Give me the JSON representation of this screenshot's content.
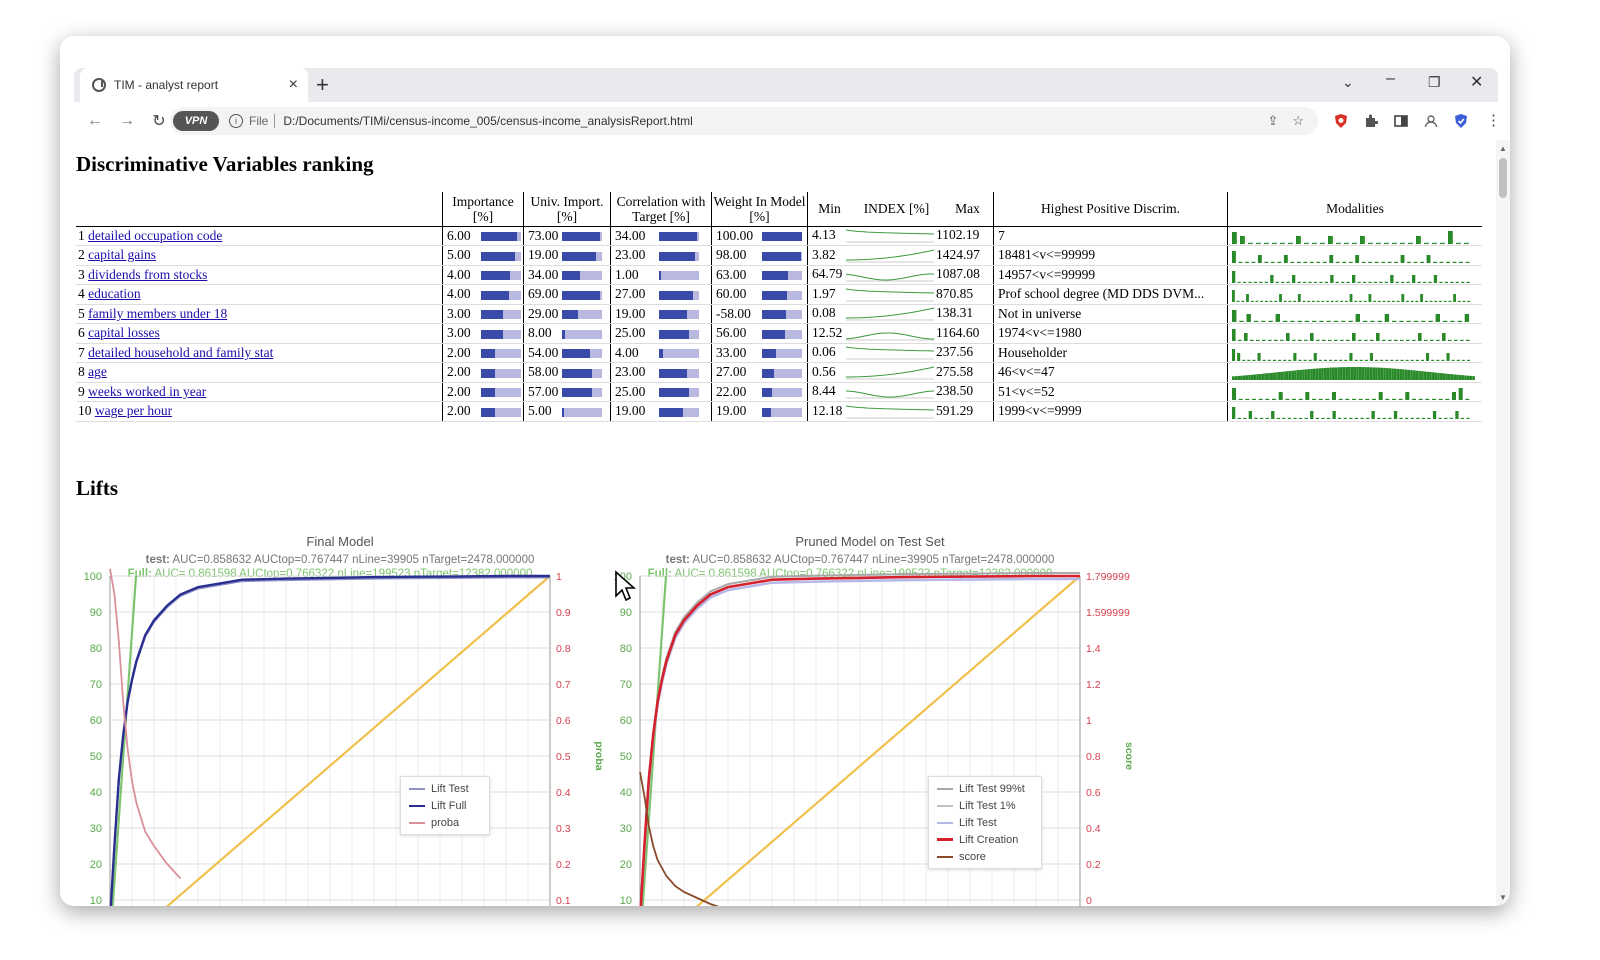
{
  "browser": {
    "tab_title": "TIM - analyst report",
    "new_tab": "+",
    "vpn_label": "VPN",
    "file_label": "File",
    "url": "D:/Documents/TIMi/census-income_005/census-income_analysisReport.html"
  },
  "ranking": {
    "heading": "Discriminative Variables ranking",
    "headers": {
      "importance": "Importance [%]",
      "univ_import": "Univ. Import. [%]",
      "correlation": "Correlation with Target [%]",
      "weight": "Weight In Model [%]",
      "min": "Min",
      "index": "INDEX [%]",
      "max": "Max",
      "highest": "Highest Positive Discrim.",
      "modalities": "Modalities"
    },
    "rows": [
      {
        "rank": "1",
        "name": "detailed occupation code",
        "importance": "6.00",
        "imp_frac": 0.9,
        "univ": "73.00",
        "univ_frac": 0.95,
        "corr": "34.00",
        "corr_frac": 0.95,
        "weight": "100.00",
        "weight_frac": 1.0,
        "min": "4.13",
        "max": "1102.19",
        "highest": "7"
      },
      {
        "rank": "2",
        "name": "capital gains",
        "importance": "5.00",
        "imp_frac": 0.85,
        "univ": "19.00",
        "univ_frac": 0.85,
        "corr": "23.00",
        "corr_frac": 0.9,
        "weight": "98.00",
        "weight_frac": 0.98,
        "min": "3.82",
        "max": "1424.97",
        "highest": "18481<v<=99999"
      },
      {
        "rank": "3",
        "name": "dividends from stocks",
        "importance": "4.00",
        "imp_frac": 0.72,
        "univ": "34.00",
        "univ_frac": 0.45,
        "corr": "1.00",
        "corr_frac": 0.05,
        "weight": "63.00",
        "weight_frac": 0.65,
        "min": "64.79",
        "max": "1087.08",
        "highest": "14957<v<=99999"
      },
      {
        "rank": "4",
        "name": "education",
        "importance": "4.00",
        "imp_frac": 0.7,
        "univ": "69.00",
        "univ_frac": 0.95,
        "corr": "27.00",
        "corr_frac": 0.85,
        "weight": "60.00",
        "weight_frac": 0.62,
        "min": "1.97",
        "max": "870.85",
        "highest": "Prof school degree (MD DDS DVM..."
      },
      {
        "rank": "5",
        "name": "family members under 18",
        "importance": "3.00",
        "imp_frac": 0.55,
        "univ": "29.00",
        "univ_frac": 0.4,
        "corr": "19.00",
        "corr_frac": 0.7,
        "weight": "-58.00",
        "weight_frac": 0.6,
        "min": "0.08",
        "max": "138.31",
        "highest": "Not in universe"
      },
      {
        "rank": "6",
        "name": "capital losses",
        "importance": "3.00",
        "imp_frac": 0.55,
        "univ": "8.00",
        "univ_frac": 0.08,
        "corr": "25.00",
        "corr_frac": 0.75,
        "weight": "56.00",
        "weight_frac": 0.58,
        "min": "12.52",
        "max": "1164.60",
        "highest": "1974<v<=1980"
      },
      {
        "rank": "7",
        "name": "detailed household and family stat",
        "importance": "2.00",
        "imp_frac": 0.35,
        "univ": "54.00",
        "univ_frac": 0.7,
        "corr": "4.00",
        "corr_frac": 0.1,
        "weight": "33.00",
        "weight_frac": 0.35,
        "min": "0.06",
        "max": "237.56",
        "highest": "Householder"
      },
      {
        "rank": "8",
        "name": "age",
        "importance": "2.00",
        "imp_frac": 0.35,
        "univ": "58.00",
        "univ_frac": 0.75,
        "corr": "23.00",
        "corr_frac": 0.7,
        "weight": "27.00",
        "weight_frac": 0.3,
        "min": "0.56",
        "max": "275.58",
        "highest": "46<v<=47"
      },
      {
        "rank": "9",
        "name": "weeks worked in year",
        "importance": "2.00",
        "imp_frac": 0.35,
        "univ": "57.00",
        "univ_frac": 0.75,
        "corr": "25.00",
        "corr_frac": 0.75,
        "weight": "22.00",
        "weight_frac": 0.25,
        "min": "8.44",
        "max": "238.50",
        "highest": "51<v<=52"
      },
      {
        "rank": "10",
        "name": "wage per hour",
        "importance": "2.00",
        "imp_frac": 0.35,
        "univ": "5.00",
        "univ_frac": 0.05,
        "corr": "19.00",
        "corr_frac": 0.6,
        "weight": "19.00",
        "weight_frac": 0.22,
        "min": "12.18",
        "max": "591.29",
        "highest": "1999<v<=9999"
      }
    ]
  },
  "lifts": {
    "heading": "Lifts"
  },
  "chart_data": [
    {
      "type": "line",
      "title": "Final Model",
      "subtitle_test": "AUC=0.858632 AUCtop=0.767447 nLine=39905 nTarget=2478.000000",
      "subtitle_full": "AUC= 0.861598 AUCtop=0.766322 nLine=199523 nTarget=12382.000000",
      "test_label": "test:",
      "full_label": "Full:",
      "ylabel_right": "proba",
      "yticks_left": [
        "100",
        "90",
        "80",
        "70",
        "60",
        "50",
        "40",
        "30",
        "20",
        "10"
      ],
      "yticks_right": [
        "1",
        "0.9",
        "0.8",
        "0.7",
        "0.6",
        "0.5",
        "0.4",
        "0.3",
        "0.2",
        "0.1"
      ],
      "legend": [
        "Lift Test",
        "Lift Full",
        "proba"
      ],
      "colors": {
        "lift_test": "#8f92c8",
        "lift_full": "#2a2f8f",
        "proba": "#d9909a",
        "diagonal": "#f0c04a",
        "ideal": "#7ec46f"
      },
      "series": [
        {
          "name": "Lift Full",
          "x": [
            0,
            1,
            2,
            3,
            4,
            5,
            6,
            8,
            10,
            13,
            16,
            20,
            25,
            30,
            40,
            50,
            60,
            70,
            80,
            90,
            100
          ],
          "y": [
            7,
            27,
            45,
            57,
            66,
            72,
            77,
            84,
            88,
            92,
            95,
            97,
            98,
            99,
            99.3,
            99.5,
            99.7,
            99.8,
            99.9,
            100,
            100
          ]
        },
        {
          "name": "proba",
          "x": [
            0,
            1,
            2,
            3,
            4,
            5,
            6,
            8,
            10,
            13,
            16
          ],
          "y": [
            0.92,
            0.85,
            0.72,
            0.55,
            0.42,
            0.33,
            0.27,
            0.19,
            0.15,
            0.1,
            0.06
          ]
        }
      ]
    },
    {
      "type": "line",
      "title": "Pruned Model on Test Set",
      "subtitle_test": "AUC=0.858632 AUCtop=0.767447 nLine=39905 nTarget=2478.000000",
      "subtitle_full": "AUC= 0.861598 AUCtop=0.766322 nLine=199523 nTarget=12382.000000",
      "test_label": "test:",
      "full_label": "Full:",
      "ylabel_right": "score",
      "yticks_left": [
        "100",
        "90",
        "80",
        "70",
        "60",
        "50",
        "40",
        "30",
        "20",
        "10"
      ],
      "yticks_right": [
        "1.799999",
        "1.599999",
        "1.4",
        "1.2",
        "1",
        "0.8",
        "0.6",
        "0.4",
        "0.2",
        "0"
      ],
      "legend": [
        "Lift Test 99%t",
        "Lift Test 1%",
        "Lift Test",
        "Lift Creation",
        "score"
      ],
      "colors": {
        "lift_test_99": "#a8a8a8",
        "lift_test_1": "#c0c0c0",
        "lift_test": "#b6b8e8",
        "lift_creation": "#d6202c",
        "score": "#8a4a2a",
        "diagonal": "#f0c04a",
        "ideal": "#7ec46f"
      },
      "series": [
        {
          "name": "Lift Creation",
          "x": [
            0,
            1,
            2,
            3,
            4,
            5,
            6,
            8,
            10,
            13,
            16,
            20,
            25,
            30,
            40,
            50,
            60,
            70,
            80,
            90,
            100
          ],
          "y": [
            7,
            27,
            45,
            57,
            66,
            72,
            77,
            84,
            88,
            92,
            95,
            97,
            98,
            99,
            99.3,
            99.5,
            99.7,
            99.8,
            99.9,
            100,
            100
          ]
        },
        {
          "name": "score",
          "x": [
            0,
            1,
            2,
            3,
            4,
            6,
            8,
            10,
            13,
            16,
            20,
            25,
            30,
            35,
            40
          ],
          "y": [
            0.82,
            0.7,
            0.55,
            0.45,
            0.38,
            0.3,
            0.25,
            0.22,
            0.19,
            0.16,
            0.13,
            0.09,
            0.05,
            0.02,
            0
          ]
        }
      ]
    }
  ]
}
